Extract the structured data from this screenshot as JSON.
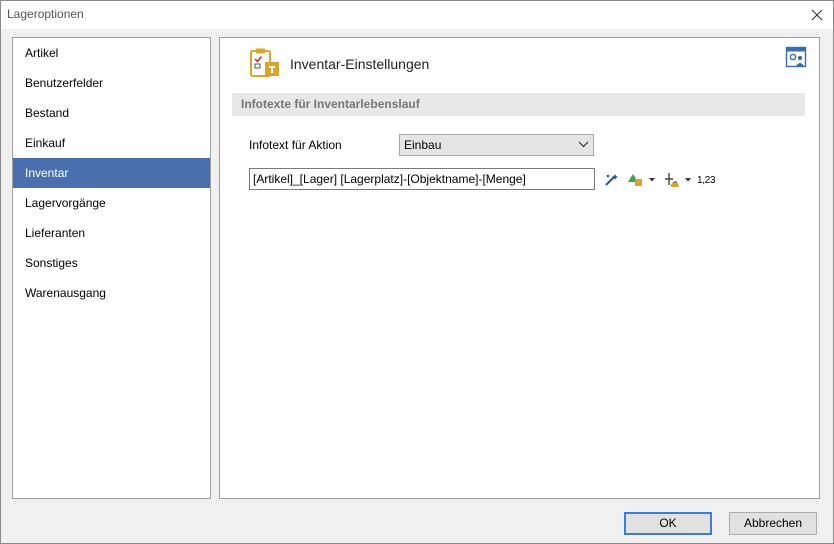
{
  "window": {
    "title": "Lageroptionen"
  },
  "nav": {
    "items": [
      {
        "label": "Artikel"
      },
      {
        "label": "Benutzerfelder"
      },
      {
        "label": "Bestand"
      },
      {
        "label": "Einkauf"
      },
      {
        "label": "Inventar",
        "selected": true
      },
      {
        "label": "Lagervorgänge"
      },
      {
        "label": "Lieferanten"
      },
      {
        "label": "Sonstiges"
      },
      {
        "label": "Warenausgang"
      }
    ]
  },
  "page": {
    "title": "Inventar-Einstellungen",
    "title_icon": "inventory-clipboard-icon",
    "settings_icon": "user-settings-icon"
  },
  "section": {
    "header": "Infotexte für Inventarlebenslauf"
  },
  "form": {
    "action_label": "Infotext für Aktion",
    "action_value": "Einbau",
    "infotext_value": "[Artikel]_[Lager] [Lagerplatz]-[Objektname]-[Menge]",
    "toolbar": {
      "wand_icon": "magic-wand-icon",
      "shapes_icon": "insert-object-icon",
      "field_icon": "insert-field-icon",
      "number_label": "1,23"
    }
  },
  "buttons": {
    "ok": "OK",
    "cancel": "Abbrechen"
  },
  "colors": {
    "selection": "#4a6faf",
    "default_border": "#3c7fd6",
    "accent": "#d9a52b"
  }
}
